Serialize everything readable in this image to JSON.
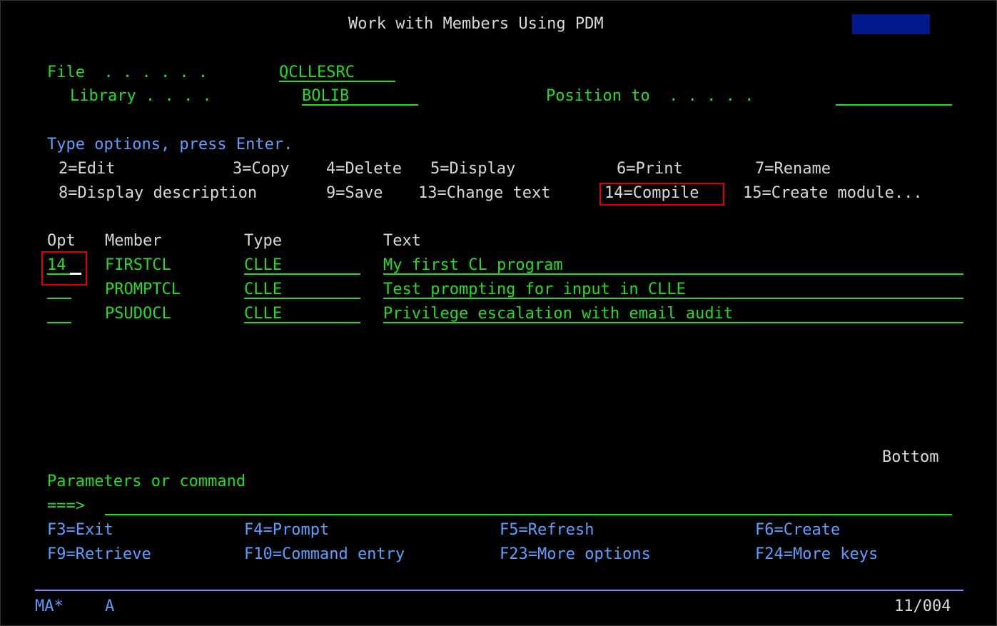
{
  "header": {
    "title": "Work with Members Using PDM"
  },
  "file_info": {
    "file_label": "File  . . . . . .",
    "file_value": "QCLLESRC",
    "library_label": "Library . . . .",
    "library_value": "BOLIB",
    "position_label": "Position to  . . . . .",
    "position_value": ""
  },
  "instructions": {
    "prompt": "Type options, press Enter.",
    "options": [
      "2=Edit",
      "3=Copy",
      "4=Delete",
      "5=Display",
      "6=Print",
      "7=Rename",
      "8=Display description",
      "9=Save",
      "13=Change text",
      "14=Compile",
      "15=Create module..."
    ]
  },
  "table": {
    "columns": [
      "Opt",
      "Member",
      "Type",
      "Text"
    ],
    "rows": [
      {
        "opt": "14",
        "member": "FIRSTCL",
        "type": "CLLE",
        "text": "My first CL program"
      },
      {
        "opt": "",
        "member": "PROMPTCL",
        "type": "CLLE",
        "text": "Test prompting for input in CLLE"
      },
      {
        "opt": "",
        "member": "PSUDOCL",
        "type": "CLLE",
        "text": "Privilege escalation with email audit"
      }
    ]
  },
  "footer": {
    "bottom_indicator": "Bottom",
    "parameters_label": "Parameters or command",
    "command_prompt": "===>",
    "command_value": "",
    "function_keys": [
      "F3=Exit",
      "F4=Prompt",
      "F5=Refresh",
      "F6=Create",
      "F9=Retrieve",
      "F10=Command entry",
      "F23=More options",
      "F24=More keys"
    ]
  },
  "status_line": {
    "session": "MA*",
    "mode": "A",
    "cursor_position": "11/004"
  },
  "colors": {
    "background": "#000000",
    "field_text": "#22dd22",
    "label_text": "#d8d8d8",
    "highlight": "#e00000",
    "status_block": "#001a8c",
    "rule": "#8888ff"
  }
}
